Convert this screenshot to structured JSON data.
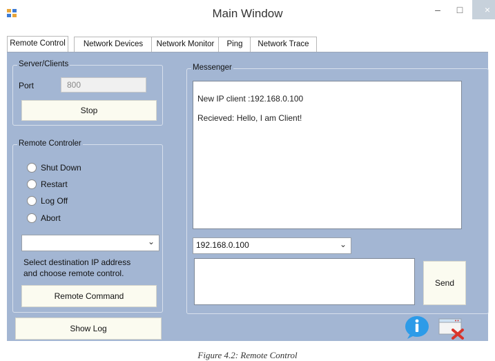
{
  "window": {
    "title": "Main Window",
    "minimize_label": "–",
    "maximize_label": "□",
    "close_label": "×"
  },
  "tabs": [
    {
      "label": "Remote Control"
    },
    {
      "label": "Network Devices"
    },
    {
      "label": "Network Monitor"
    },
    {
      "label": "Ping"
    },
    {
      "label": "Network Trace"
    }
  ],
  "server": {
    "group_label": "Server/Clients",
    "port_label": "Port",
    "port_value": "800",
    "stop_label": "Stop"
  },
  "remote": {
    "group_label": "Remote Controler",
    "options": [
      {
        "label": "Shut Down"
      },
      {
        "label": "Restart"
      },
      {
        "label": "Log Off"
      },
      {
        "label": "Abort"
      }
    ],
    "combo_value": "",
    "help_line1": "Select destination IP address",
    "help_line2": "and choose remote control.",
    "command_label": "Remote Command"
  },
  "show_log_label": "Show Log",
  "messenger": {
    "group_label": "Messenger",
    "messages": [
      {
        "text": "New IP client :192.168.0.100"
      },
      {
        "text": "Recieved: Hello, I am Client!"
      }
    ],
    "ip_value": "192.168.0.100",
    "message_input_value": "",
    "send_label": "Send"
  },
  "colors": {
    "client_bg": "#a3b6d3",
    "button_bg": "#fbfbf0",
    "info_blue": "#2d9be8",
    "close_red": "#d9342b"
  },
  "caption": "Figure 4.2: Remote Control"
}
